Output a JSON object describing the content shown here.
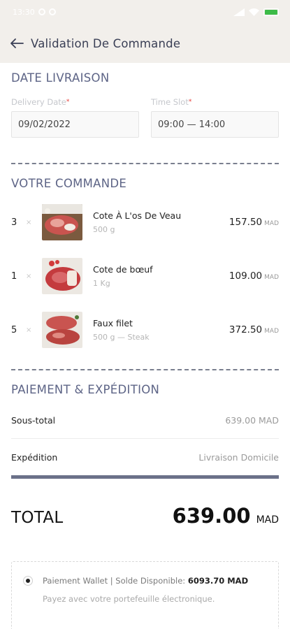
{
  "status_bar": {
    "time": "13:30"
  },
  "header": {
    "title": "Validation De Commande"
  },
  "delivery": {
    "section_title": "DATE LIVRAISON",
    "date_label": "Delivery Date",
    "date_value": "09/02/2022",
    "time_label": "Time Slot",
    "time_value": "09:00 — 14:00",
    "required_mark": "*"
  },
  "order": {
    "section_title": "VOTRE COMMANDE",
    "times_symbol": "×",
    "currency": "MAD",
    "items": [
      {
        "qty": "3",
        "name": "Cote À L'os De Veau",
        "detail": "500 g",
        "price": "157.50"
      },
      {
        "qty": "1",
        "name": "Cote de bœuf",
        "detail": "1 Kg",
        "price": "109.00"
      },
      {
        "qty": "5",
        "name": "Faux filet",
        "detail": "500 g — Steak",
        "price": "372.50"
      }
    ]
  },
  "payment": {
    "section_title": "PAIEMENT & EXPÉDITION",
    "subtotal_label": "Sous-total",
    "subtotal_value": "639.00 MAD",
    "shipping_label": "Expédition",
    "shipping_value": "Livraison Domicile",
    "total_label": "TOTAL",
    "total_value": "639.00",
    "total_currency": "MAD",
    "wallet_text": "Paiement Wallet | Solde Disponible:",
    "wallet_balance": "6093.70 MAD",
    "wallet_sub": "Payez avec votre portefeuille électronique."
  },
  "colors": {
    "header_bg": "#f2efeb",
    "section_title": "#5d6486",
    "divider": "#6b7189"
  }
}
